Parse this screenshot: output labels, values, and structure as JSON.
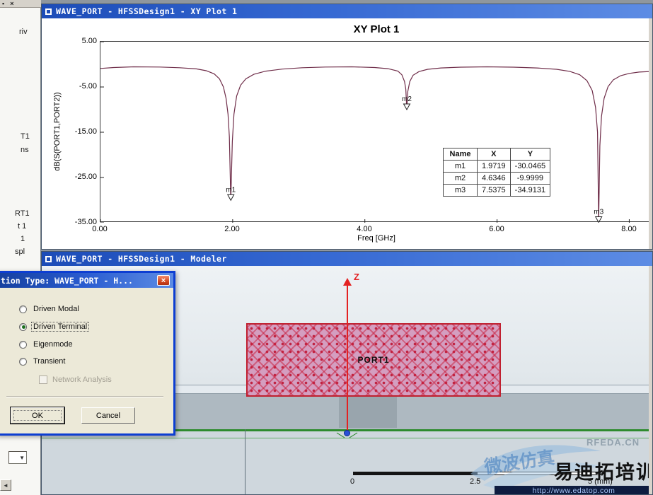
{
  "left_panel": {
    "icons": {
      "box": "▪",
      "close": "×",
      "dropdown": "▼",
      "arrow": "◄"
    },
    "fragments": [
      "riv",
      "T1",
      "ns",
      "RT1",
      "t 1",
      "1",
      "spl"
    ]
  },
  "plot_window": {
    "title": "WAVE_PORT - HFSSDesign1 - XY Plot 1"
  },
  "modeler_window": {
    "title": "WAVE_PORT - HFSSDesign1 - Modeler",
    "port_label": "PORT1",
    "z_axis_label": "Z",
    "ruler": {
      "t0": "0",
      "t1": "2.5",
      "t2": "5 (mm)"
    }
  },
  "dialog": {
    "title": "tion Type: WAVE_PORT - H...",
    "close": "×",
    "options": [
      "Driven Modal",
      "Driven Terminal",
      "Eigenmode",
      "Transient"
    ],
    "selected_index": 1,
    "network_analysis_label": "Network Analysis",
    "ok_label": "OK",
    "cancel_label": "Cancel"
  },
  "watermarks": {
    "rfeda": "RFEDA.CN",
    "weibo": "微波仿真",
    "yiditu": "易迪拓培训",
    "url": "http://www.edatop.com"
  },
  "chart_data": {
    "type": "line",
    "title": "XY Plot 1",
    "xlabel": "Freq [GHz]",
    "ylabel": "dB(S(PORT1,PORT2))",
    "xlim": [
      0,
      8.37
    ],
    "ylim": [
      -35,
      5
    ],
    "grid": false,
    "xticks": [
      "0.00",
      "2.00",
      "4.00",
      "6.00",
      "8.00"
    ],
    "yticks": [
      "5.00",
      "-5.00",
      "-15.00",
      "-25.00",
      "-35.00"
    ],
    "series": [
      {
        "name": "dB(S(PORT1,PORT2))",
        "color": "#6e2c48",
        "points": [
          [
            0,
            -0.9
          ],
          [
            0.2,
            -0.7
          ],
          [
            0.5,
            -0.55
          ],
          [
            0.9,
            -0.6
          ],
          [
            1.2,
            -0.75
          ],
          [
            1.45,
            -1.0
          ],
          [
            1.6,
            -1.4
          ],
          [
            1.72,
            -2.1
          ],
          [
            1.8,
            -3.2
          ],
          [
            1.86,
            -5
          ],
          [
            1.9,
            -7.5
          ],
          [
            1.93,
            -11
          ],
          [
            1.95,
            -16
          ],
          [
            1.9719,
            -30.05
          ],
          [
            1.995,
            -17
          ],
          [
            2.02,
            -11
          ],
          [
            2.06,
            -7
          ],
          [
            2.12,
            -4.6
          ],
          [
            2.2,
            -3.2
          ],
          [
            2.32,
            -2.2
          ],
          [
            2.5,
            -1.5
          ],
          [
            2.75,
            -1.05
          ],
          [
            3.05,
            -0.75
          ],
          [
            3.4,
            -0.6
          ],
          [
            3.8,
            -0.55
          ],
          [
            4.15,
            -0.7
          ],
          [
            4.35,
            -0.95
          ],
          [
            4.5,
            -1.5
          ],
          [
            4.56,
            -2.3
          ],
          [
            4.6,
            -3.8
          ],
          [
            4.62,
            -5.5
          ],
          [
            4.6346,
            -10
          ],
          [
            4.65,
            -6
          ],
          [
            4.68,
            -3.8
          ],
          [
            4.73,
            -2.4
          ],
          [
            4.82,
            -1.6
          ],
          [
            4.95,
            -1.1
          ],
          [
            5.15,
            -0.8
          ],
          [
            5.45,
            -0.62
          ],
          [
            5.85,
            -0.55
          ],
          [
            6.25,
            -0.62
          ],
          [
            6.6,
            -0.8
          ],
          [
            6.9,
            -1.1
          ],
          [
            7.1,
            -1.55
          ],
          [
            7.25,
            -2.3
          ],
          [
            7.36,
            -3.6
          ],
          [
            7.44,
            -5.8
          ],
          [
            7.49,
            -9.5
          ],
          [
            7.52,
            -15
          ],
          [
            7.5375,
            -34.91
          ],
          [
            7.555,
            -18
          ],
          [
            7.58,
            -11.5
          ],
          [
            7.62,
            -7.5
          ],
          [
            7.68,
            -4.9
          ],
          [
            7.76,
            -3.4
          ],
          [
            7.87,
            -2.5
          ],
          [
            8.0,
            -2.0
          ],
          [
            8.15,
            -1.7
          ],
          [
            8.37,
            -1.55
          ]
        ]
      }
    ],
    "markers": [
      {
        "name": "m1",
        "x": "1.9719",
        "y": "-30.0465"
      },
      {
        "name": "m2",
        "x": "4.6346",
        "y": "-9.9999"
      },
      {
        "name": "m3",
        "x": "7.5375",
        "y": "-34.9131"
      }
    ],
    "table_headers": [
      "Name",
      "X",
      "Y"
    ]
  }
}
